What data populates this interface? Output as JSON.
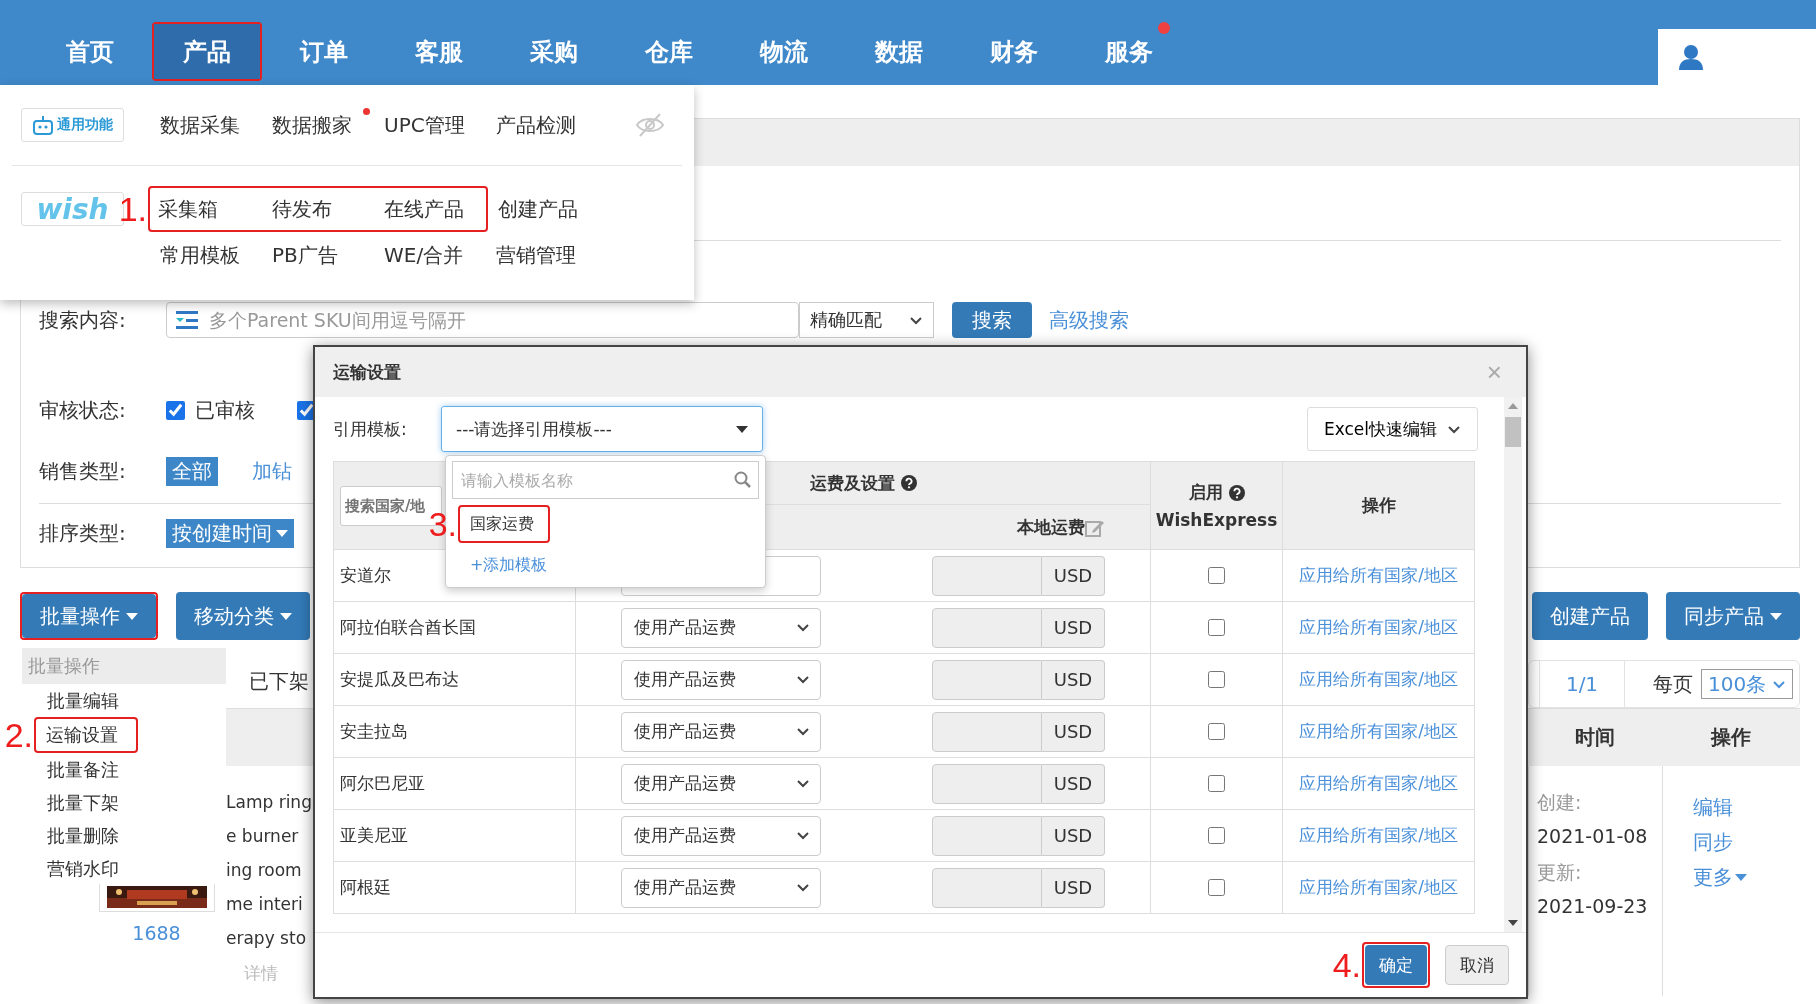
{
  "nav": {
    "items": [
      {
        "label": "首页",
        "selected": false,
        "highlighted": false,
        "dot": false
      },
      {
        "label": "产品",
        "selected": true,
        "highlighted": true,
        "dot": false
      },
      {
        "label": "订单",
        "selected": false,
        "highlighted": false,
        "dot": false
      },
      {
        "label": "客服",
        "selected": false,
        "highlighted": false,
        "dot": false
      },
      {
        "label": "采购",
        "selected": false,
        "highlighted": false,
        "dot": false
      },
      {
        "label": "仓库",
        "selected": false,
        "highlighted": false,
        "dot": false
      },
      {
        "label": "物流",
        "selected": false,
        "highlighted": false,
        "dot": false
      },
      {
        "label": "数据",
        "selected": false,
        "highlighted": false,
        "dot": false
      },
      {
        "label": "财务",
        "selected": false,
        "highlighted": false,
        "dot": false
      },
      {
        "label": "服务",
        "selected": false,
        "highlighted": false,
        "dot": true
      }
    ]
  },
  "product_menu": {
    "general": {
      "logo": "通用功能",
      "items": [
        {
          "label": "数据采集",
          "dot": false
        },
        {
          "label": "数据搬家",
          "dot": true
        },
        {
          "label": "UPC管理",
          "dot": false
        },
        {
          "label": "产品检测",
          "dot": false
        }
      ]
    },
    "wish": {
      "logo": "wish",
      "annotation": "1.",
      "rows": [
        {
          "items": [
            {
              "label": "采集箱",
              "highlighted": true
            },
            {
              "label": "待发布",
              "highlighted": true
            },
            {
              "label": "在线产品",
              "highlighted": true
            },
            {
              "label": "创建产品",
              "highlighted": false
            }
          ]
        },
        {
          "items": [
            {
              "label": "常用模板",
              "highlighted": false
            },
            {
              "label": "PB广告",
              "highlighted": false
            },
            {
              "label": "WE/合并",
              "highlighted": false
            },
            {
              "label": "营销管理",
              "highlighted": false
            }
          ]
        }
      ]
    }
  },
  "search": {
    "label": "搜索内容:",
    "placeholder": "多个Parent SKU间用逗号隔开",
    "match": "精确匹配",
    "button": "搜索",
    "advanced": "高级搜索"
  },
  "filters": {
    "review": {
      "label": "审核状态:",
      "options": [
        {
          "label": "已审核",
          "checked": true
        },
        {
          "checked": true
        }
      ]
    },
    "sale_type": {
      "label": "销售类型:",
      "options": [
        {
          "label": "全部",
          "selected": true
        },
        {
          "label": "加钻",
          "selected": false
        }
      ]
    },
    "sort": {
      "label": "排序类型:",
      "value": "按创建时间"
    }
  },
  "toolbar": {
    "left": [
      {
        "label": "批量操作",
        "highlighted": true
      },
      {
        "label": "移动分类",
        "highlighted": false
      }
    ],
    "right": [
      {
        "label": "创建产品",
        "caret": false
      },
      {
        "label": "同步产品",
        "caret": true
      }
    ]
  },
  "batch_menu": {
    "header": "批量操作",
    "items": [
      {
        "label": "批量编辑",
        "highlighted": false
      },
      {
        "label": "运输设置",
        "highlighted": true,
        "annotation": "2."
      },
      {
        "label": "批量备注",
        "highlighted": false
      },
      {
        "label": "批量下架",
        "highlighted": false
      },
      {
        "label": "批量删除",
        "highlighted": false
      },
      {
        "label": "营销水印",
        "highlighted": false
      }
    ]
  },
  "list": {
    "status": "已下架",
    "pagination": {
      "page": "1/1",
      "per_page_label": "每页",
      "per_page": "100条"
    },
    "columns": [
      "时间",
      "操作"
    ],
    "product": {
      "kind": "picture",
      "source": "1688",
      "title_lines": [
        "Lamp ring",
        "e burner",
        "ing room",
        "me interi",
        "erapy sto"
      ],
      "detail": "详情"
    },
    "time": {
      "created_label": "创建:",
      "created": "2021-01-08",
      "updated_label": "更新:",
      "updated": "2021-09-23"
    },
    "actions": [
      {
        "label": "编辑",
        "caret": false
      },
      {
        "label": "同步",
        "caret": false
      },
      {
        "label": "更多",
        "caret": true
      }
    ]
  },
  "modal": {
    "title": "运输设置",
    "close": "×",
    "template_label": "引用模板:",
    "template_value": "---请选择引用模板---",
    "excel": "Excel快速编辑",
    "country_search_placeholder": "搜索国家/地",
    "headers": {
      "fee": "运费及设置",
      "local_fee": "本地运费",
      "enable": "启用",
      "wish_express": "WishExpress",
      "action": "操作"
    },
    "rows": [
      {
        "country": "安道尔",
        "currency": "USD",
        "wish_express": false,
        "action": "应用给所有国家/地区"
      },
      {
        "country": "阿拉伯联合酋长国",
        "shipping": "使用产品运费",
        "currency": "USD",
        "wish_express": false,
        "action": "应用给所有国家/地区"
      },
      {
        "country": "安提瓜及巴布达",
        "shipping": "使用产品运费",
        "currency": "USD",
        "wish_express": false,
        "action": "应用给所有国家/地区"
      },
      {
        "country": "安圭拉岛",
        "shipping": "使用产品运费",
        "currency": "USD",
        "wish_express": false,
        "action": "应用给所有国家/地区"
      },
      {
        "country": "阿尔巴尼亚",
        "shipping": "使用产品运费",
        "currency": "USD",
        "wish_express": false,
        "action": "应用给所有国家/地区"
      },
      {
        "country": "亚美尼亚",
        "shipping": "使用产品运费",
        "currency": "USD",
        "wish_express": false,
        "action": "应用给所有国家/地区"
      },
      {
        "country": "阿根廷",
        "shipping": "使用产品运费",
        "currency": "USD",
        "wish_express": false,
        "action": "应用给所有国家/地区"
      }
    ],
    "template_dropdown": {
      "placeholder": "请输入模板名称",
      "options": [
        {
          "label": "国家运费",
          "highlighted": true,
          "annotation": "3."
        }
      ],
      "add": "+添加模板"
    },
    "buttons": [
      {
        "label": "确定",
        "kind": "primary",
        "highlighted": true,
        "annotation": "4."
      },
      {
        "label": "取消",
        "kind": "default",
        "highlighted": false
      }
    ]
  }
}
